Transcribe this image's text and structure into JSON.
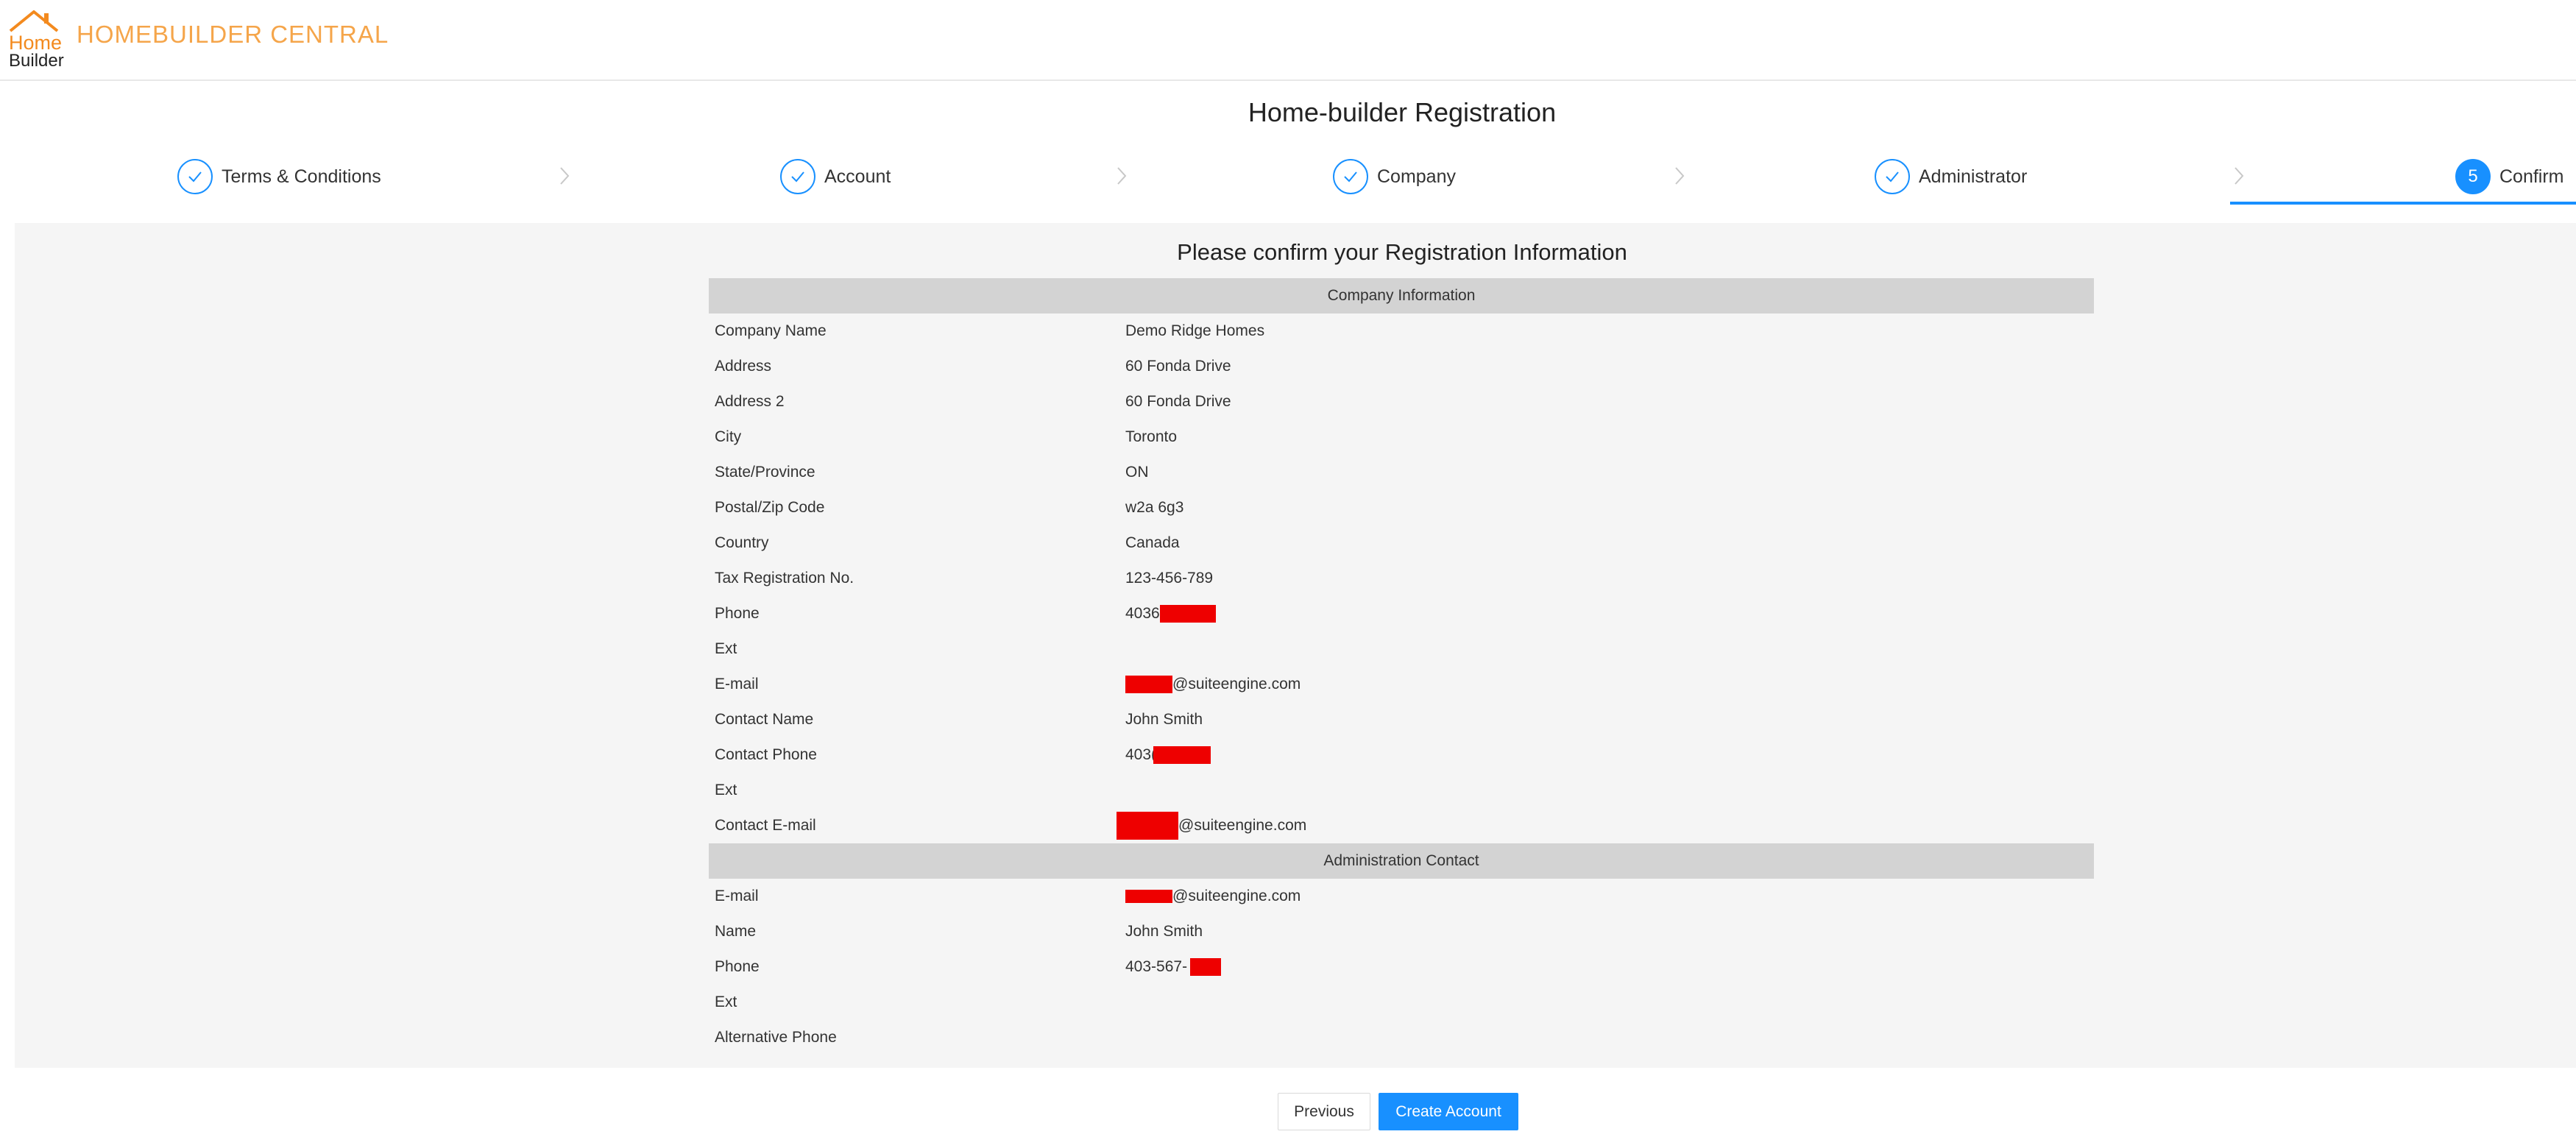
{
  "header": {
    "logo_home": "Home",
    "logo_builder": "Builder",
    "brand": "HOMEBUILDER CENTRAL"
  },
  "page": {
    "title": "Home-builder Registration"
  },
  "steps": [
    {
      "label": "Terms & Conditions",
      "state": "done"
    },
    {
      "label": "Account",
      "state": "done"
    },
    {
      "label": "Company",
      "state": "done"
    },
    {
      "label": "Administrator",
      "state": "done"
    },
    {
      "label": "Confirm",
      "state": "active",
      "number": "5"
    }
  ],
  "confirm": {
    "title": "Please confirm your Registration Information",
    "company_header": "Company Information",
    "admin_header": "Administration Contact",
    "company_rows": [
      {
        "label": "Company Name",
        "value": "Demo Ridge Homes"
      },
      {
        "label": "Address",
        "value": "60 Fonda Drive"
      },
      {
        "label": "Address 2",
        "value": "60 Fonda Drive"
      },
      {
        "label": "City",
        "value": "Toronto"
      },
      {
        "label": "State/Province",
        "value": "ON"
      },
      {
        "label": "Postal/Zip Code",
        "value": "w2a 6g3"
      },
      {
        "label": "Country",
        "value": "Canada"
      },
      {
        "label": "Tax Registration No.",
        "value": "123-456-789"
      },
      {
        "label": "Phone",
        "value": "4036"
      },
      {
        "label": "Ext",
        "value": ""
      },
      {
        "label": "E-mail",
        "value": "@suiteengine.com"
      },
      {
        "label": "Contact Name",
        "value": "John Smith"
      },
      {
        "label": "Contact Phone",
        "value": "403("
      },
      {
        "label": "Ext",
        "value": ""
      },
      {
        "label": "Contact E-mail",
        "value": "@suiteengine.com"
      }
    ],
    "admin_rows": [
      {
        "label": "E-mail",
        "value": "@suiteengine.com"
      },
      {
        "label": "Name",
        "value": "John Smith"
      },
      {
        "label": "Phone",
        "value": "403-567-"
      },
      {
        "label": "Ext",
        "value": ""
      },
      {
        "label": "Alternative Phone",
        "value": ""
      }
    ]
  },
  "buttons": {
    "previous": "Previous",
    "create": "Create Account"
  },
  "colors": {
    "accent": "#1890ff",
    "brand": "#f5a54a",
    "redaction": "#ee0000",
    "section_header_bg": "#d3d3d3"
  }
}
